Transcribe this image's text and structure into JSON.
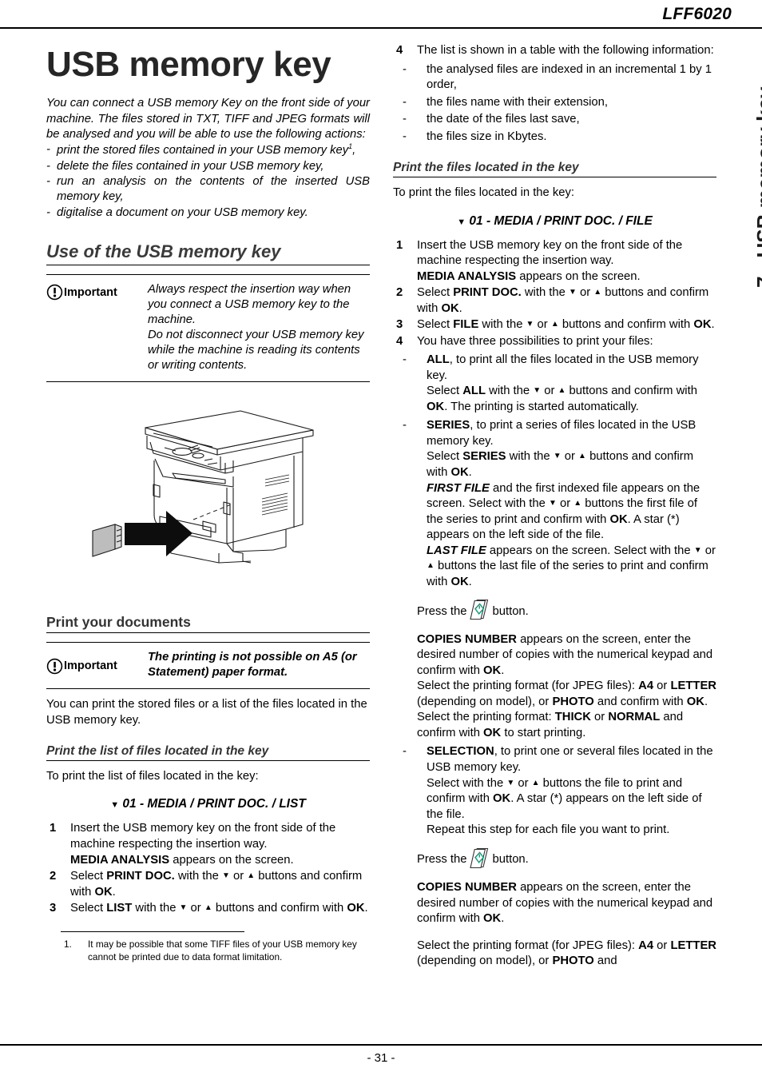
{
  "header": {
    "model": "LFF6020"
  },
  "footer": {
    "page_number": "- 31 -"
  },
  "side_tab": {
    "label": "7 - USB memory key"
  },
  "left_column": {
    "title": "USB memory key",
    "intro": "You can connect a USB memory Key on the front side of your machine. The files stored in TXT, TIFF and JPEG formats will be analysed and you will be able to use the following actions:",
    "intro_items": [
      "print the stored files contained in your USB memory key",
      "delete the files contained in your USB memory key,",
      "run an analysis on the contents of the inserted USB memory key,",
      "digitalise a document on your USB memory key."
    ],
    "intro_item1_footnote_marker": "1",
    "intro_item1_tail": ",",
    "section_use": "Use of the USB memory key",
    "important_label": "Important",
    "important_1_line1": "Always respect the insertion way when you connect a USB memory key to the machine.",
    "important_1_line2": "Do not disconnect your USB memory key while the machine is reading its contents or writing contents.",
    "illustration_alt": "multifunction printer with USB memory key inserted into front port",
    "section_print": "Print your documents",
    "important_2": "The printing is not possible on A5 (or Statement) paper format.",
    "para_print": "You can print the stored files or a list of the files located in the USB memory key.",
    "subsection_list": "Print the list of files located in the key",
    "para_list_intro": "To print the list of files located in the key:",
    "menupath_list": "01 - MEDIA / PRINT DOC. / LIST",
    "steps": [
      {
        "num": "1",
        "text_a": "Insert the USB memory key on the front side of the machine respecting the insertion way.",
        "bold_b": "MEDIA ANALYSIS",
        "text_b": " appears on the screen."
      },
      {
        "num": "2",
        "pre": "Select ",
        "bold": "PRINT DOC.",
        "mid": " with the ",
        "mid2": " or ",
        "mid3": " buttons and confirm with ",
        "bold2": "OK",
        "post": "."
      },
      {
        "num": "3",
        "pre": "Select ",
        "bold": "LIST",
        "mid": " with the ",
        "mid2": " or ",
        "mid3": " buttons and confirm with ",
        "bold2": "OK",
        "post": "."
      }
    ],
    "footnote_num": "1.",
    "footnote_text": "It may be possible that some TIFF files of your USB memory key cannot be printed due to data format limitation."
  },
  "right_column": {
    "step4_num": "4",
    "step4_text": "The list is shown in a table with the following information:",
    "step4_items": [
      "the analysed files are indexed in an incremental 1 by 1 order,",
      "the files name with their extension,",
      "the date of the files last save,",
      "the files size in Kbytes."
    ],
    "subsection_files": "Print the files located in the key",
    "para_files_intro": "To print the files located in the key:",
    "menupath_file": "01 - MEDIA / PRINT DOC. / FILE",
    "steps": [
      {
        "num": "1",
        "text_a": "Insert the USB memory key on the front side of the machine respecting the insertion way.",
        "bold_b": "MEDIA ANALYSIS",
        "text_b": " appears on the screen."
      },
      {
        "num": "2",
        "pre": "Select ",
        "bold": "PRINT DOC.",
        "mid": " with the ",
        "mid2": " or ",
        "mid3": " buttons and confirm with ",
        "bold2": "OK",
        "post": "."
      },
      {
        "num": "3",
        "pre": "Select ",
        "bold": "FILE",
        "mid": " with the ",
        "mid2": " or ",
        "mid3": " buttons and confirm with ",
        "bold2": "OK",
        "post": "."
      },
      {
        "num": "4",
        "text_a": "You have three possibilities to print your files:"
      }
    ],
    "option_all": {
      "bold": "ALL",
      "lead": ", to print all the files located in the USB memory key.",
      "l2_pre": "Select ",
      "l2_bold": "ALL",
      "l2_mid": " with the ",
      "l2_mid2": " or ",
      "l2_mid3": " buttons and confirm with ",
      "l2_bold2": "OK",
      "l2_post": ". The printing is started automatically."
    },
    "option_series": {
      "bold": "SERIES",
      "lead": ", to print a series of files located in the USB memory key.",
      "l2_pre": "Select ",
      "l2_bold": "SERIES",
      "l2_mid": " with the ",
      "l2_mid2": " or ",
      "l2_mid3": " buttons and confirm with ",
      "l2_bold2": "OK",
      "l2_post": ".",
      "l3_bi": "FIRST FILE",
      "l3_a": " and the first indexed file appears on the screen. Select with the ",
      "l3_b": " or ",
      "l3_c": " buttons the first file of the series to print and confirm with ",
      "l3_bold": "OK",
      "l3_d": ". A star (*) appears on the left side of the file.",
      "l4_bi": "LAST FILE",
      "l4_a": " appears on the screen. Select with the ",
      "l4_b": " or ",
      "l4_c": " buttons the last file of the series to print and confirm with ",
      "l4_bold": "OK",
      "l4_d": "."
    },
    "press_line": {
      "pre": "Press the ",
      "post": " button.",
      "icon_color": "#1a9e7e"
    },
    "copies_block_1": {
      "bold": "COPIES NUMBER",
      "t1": " appears on the screen, enter the desired number of copies with the numerical keypad and confirm with ",
      "b1": "OK",
      "t2": ".",
      "t3": "Select the printing format (for JPEG files): ",
      "b2": "A4",
      "t4": " or ",
      "b3": "LETTER",
      "t5": " (depending on model), or ",
      "b4": "PHOTO",
      "t6": " and confirm with ",
      "b5": "OK",
      "t7": ".",
      "t8": "Select the printing format: ",
      "b6": "THICK",
      "t9": " or ",
      "b7": "NORMAL",
      "t10": " and confirm with ",
      "b8": "OK",
      "t11": " to start printing."
    },
    "option_selection": {
      "bold": "SELECTION",
      "lead": ", to print one or several files located in the USB memory key.",
      "l2_pre": "Select with the ",
      "l2_mid": " or ",
      "l2_mid2": " buttons the file to print and confirm with ",
      "l2_bold": "OK",
      "l2_post": ". A star (*) appears on the left side of the file.",
      "l3": "Repeat this step for each file you want to print."
    },
    "copies_block_2": {
      "bold": "COPIES NUMBER",
      "t1": " appears on the screen, enter the desired number of copies with the numerical keypad and confirm with ",
      "b1": "OK",
      "t2": ".",
      "t3": "Select the printing format (for JPEG files): ",
      "b2": "A4",
      "t4": " or ",
      "b3": "LETTER",
      "t5": " (depending on model), or ",
      "b4": "PHOTO",
      "t6": " and"
    }
  }
}
